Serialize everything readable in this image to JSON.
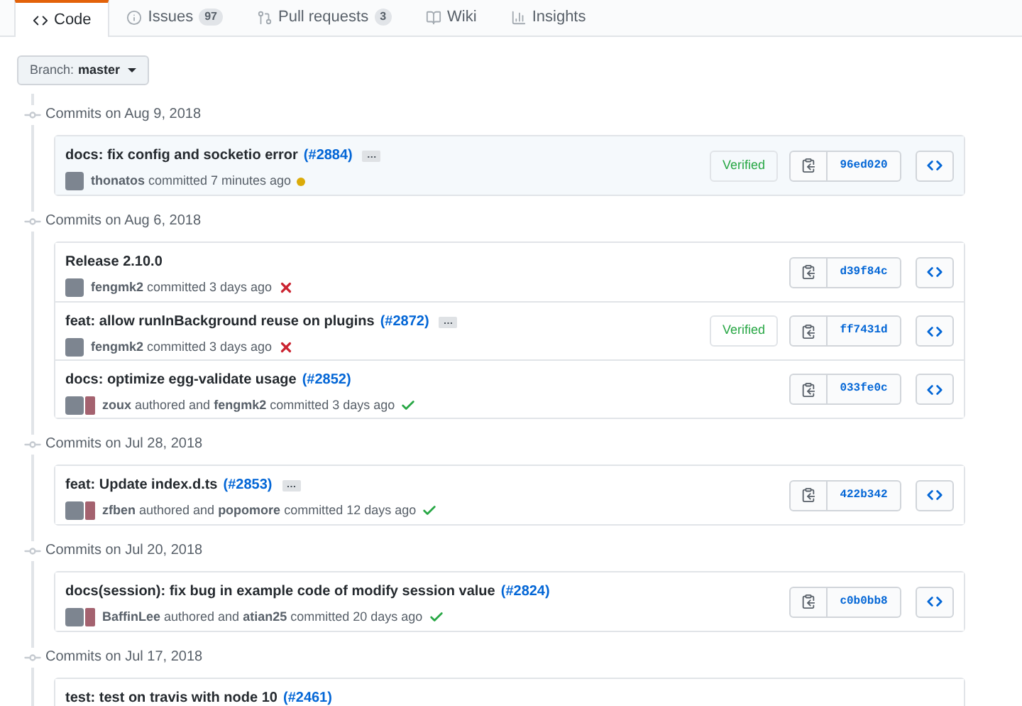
{
  "tabs": [
    {
      "label": "Code",
      "selected": true
    },
    {
      "label": "Issues",
      "count": "97",
      "selected": false
    },
    {
      "label": "Pull requests",
      "count": "3",
      "selected": false
    },
    {
      "label": "Wiki",
      "selected": false
    },
    {
      "label": "Insights",
      "selected": false
    }
  ],
  "branch_button": {
    "label": "Branch:",
    "value": "master"
  },
  "groups": [
    {
      "date": "Commits on Aug 9, 2018",
      "commits": [
        {
          "title": "docs: fix config and socketio error",
          "pr": "(#2884)",
          "ellipsis": "…",
          "coauthored": false,
          "byline": "**thonatos** committed 7 minutes ago",
          "kind": "pending",
          "verified": "Verified",
          "sha": "96ed020"
        }
      ]
    },
    {
      "date": "Commits on Aug 6, 2018",
      "commits": [
        {
          "title": "Release 2.10.0",
          "coauthored": false,
          "byline": "**fengmk2** committed 3 days ago",
          "kind": "failure",
          "sha": "d39f84c"
        },
        {
          "title": "feat: allow runInBackground reuse on plugins",
          "pr": "(#2872)",
          "ellipsis": "…",
          "coauthored": false,
          "byline": "**fengmk2** committed 3 days ago",
          "kind": "failure",
          "verified": "Verified",
          "sha": "ff7431d"
        },
        {
          "title": "docs: optimize egg-validate usage",
          "pr": "(#2852)",
          "coauthored": true,
          "byline": "**zoux** authored and **fengmk2** committed 3 days ago",
          "kind": "success",
          "sha": "033fe0c"
        }
      ]
    },
    {
      "date": "Commits on Jul 28, 2018",
      "commits": [
        {
          "title": "feat: Update index.d.ts",
          "pr": "(#2853)",
          "ellipsis": "…",
          "coauthored": true,
          "byline": "**zfben** authored and **popomore** committed 12 days ago",
          "kind": "success",
          "sha": "422b342"
        }
      ]
    },
    {
      "date": "Commits on Jul 20, 2018",
      "commits": [
        {
          "title": "docs(session): fix bug in example code of modify session value",
          "pr": "(#2824)",
          "coauthored": true,
          "byline": "**BaffinLee** authored and **atian25** committed 20 days ago",
          "kind": "success",
          "sha": "c0b0bb8"
        }
      ]
    },
    {
      "date": "Commits on Jul 17, 2018",
      "commits": [
        {
          "title": "test: test on travis with node 10",
          "pr": "(#2461)"
        }
      ]
    }
  ]
}
